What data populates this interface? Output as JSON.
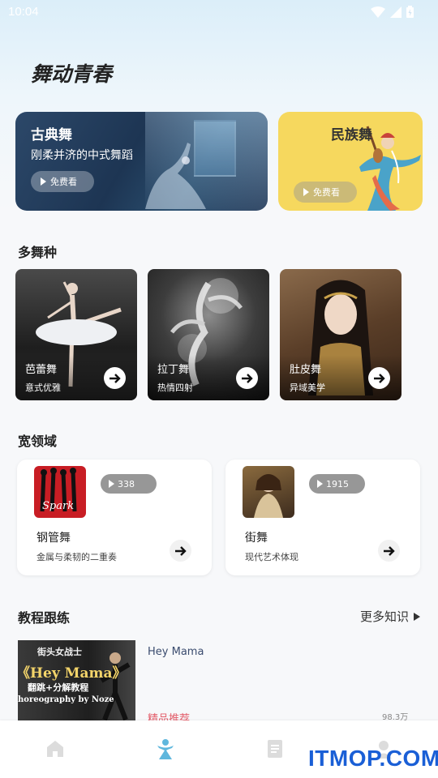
{
  "status_bar": {
    "time": "10:04"
  },
  "app": {
    "title": "舞动青春"
  },
  "banners": [
    {
      "title": "古典舞",
      "subtitle": "刚柔并济的中式舞蹈",
      "button": "免费看"
    },
    {
      "title": "民族舞",
      "button": "免费看"
    }
  ],
  "sections": {
    "styles": "多舞种",
    "fields": "宽领域",
    "tutorials": "教程跟练",
    "more": "更多知识"
  },
  "dance_styles": [
    {
      "name": "芭蕾舞",
      "desc": "意式优雅"
    },
    {
      "name": "拉丁舞",
      "desc": "热情四射"
    },
    {
      "name": "肚皮舞",
      "desc": "异域美学"
    }
  ],
  "fields": [
    {
      "name": "钢管舞",
      "desc": "金属与柔韧的二重奏",
      "plays": "338",
      "thumb_text": "Spark"
    },
    {
      "name": "街舞",
      "desc": "现代艺术体现",
      "plays": "1915"
    }
  ],
  "tutorial": {
    "title": "Hey Mama",
    "tag": "精品推荐",
    "views": "98.3万",
    "thumb_lines": [
      "街头女战士",
      "《Hey Mama》",
      "翻跳+分解教程",
      "horeography by Noze"
    ]
  },
  "bottom_nav": [
    "home-icon",
    "dance-icon",
    "document-icon",
    "profile-icon"
  ],
  "watermark": "ITMOP.COM",
  "colors": {
    "folk_banner": "#f6d85e",
    "tag_red": "#e35d6a",
    "watermark_blue": "#1a5fd6"
  }
}
